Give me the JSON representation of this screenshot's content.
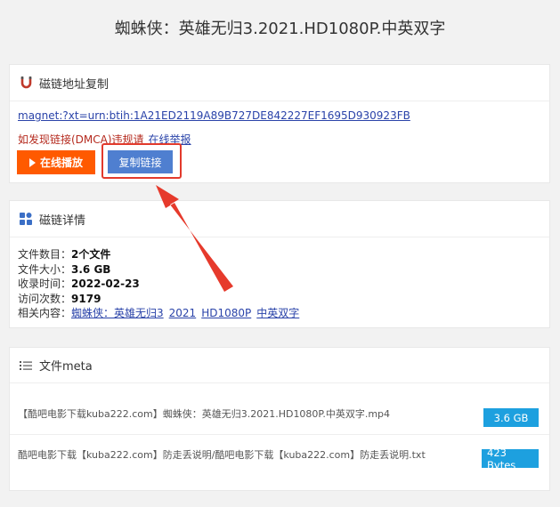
{
  "page": {
    "title": "蜘蛛侠：英雄无归3.2021.HD1080P.中英双字"
  },
  "magnet_panel": {
    "heading": "磁链地址复制",
    "magnet_uri": "magnet:?xt=urn:btih:1A21ED2119A89B727DE842227EF1695D930923FB",
    "dmca_text": "如发现链接(DMCA)违规请",
    "report_link": "在线举报",
    "play_button": "在线播放",
    "copy_button": "复制链接"
  },
  "details_panel": {
    "heading": "磁链详情",
    "rows": [
      {
        "label": "文件数目：",
        "value": "2个文件"
      },
      {
        "label": "文件大小：",
        "value": "3.6 GB"
      },
      {
        "label": "收录时间：",
        "value": "2022-02-23"
      },
      {
        "label": "访问次数：",
        "value": "9179"
      }
    ],
    "related_label": "相关内容：",
    "related_links": [
      "蜘蛛侠：英雄无归3",
      "2021",
      "HD1080P",
      "中英双字"
    ]
  },
  "meta_panel": {
    "heading": "文件meta",
    "files": [
      {
        "name": "【酷吧电影下载kuba222.com】蜘蛛侠：英雄无归3.2021.HD1080P.中英双字.mp4",
        "size": "3.6 GB"
      },
      {
        "name": "酷吧电影下载【kuba222.com】防走丢说明/酷吧电影下载【kuba222.com】防走丢说明.txt",
        "size": "423 Bytes"
      }
    ]
  },
  "colors": {
    "accent_orange": "#ff5a00",
    "copy_blue": "#4f7fd0",
    "badge_blue": "#1da0df",
    "highlight_red": "#e23a2c"
  }
}
